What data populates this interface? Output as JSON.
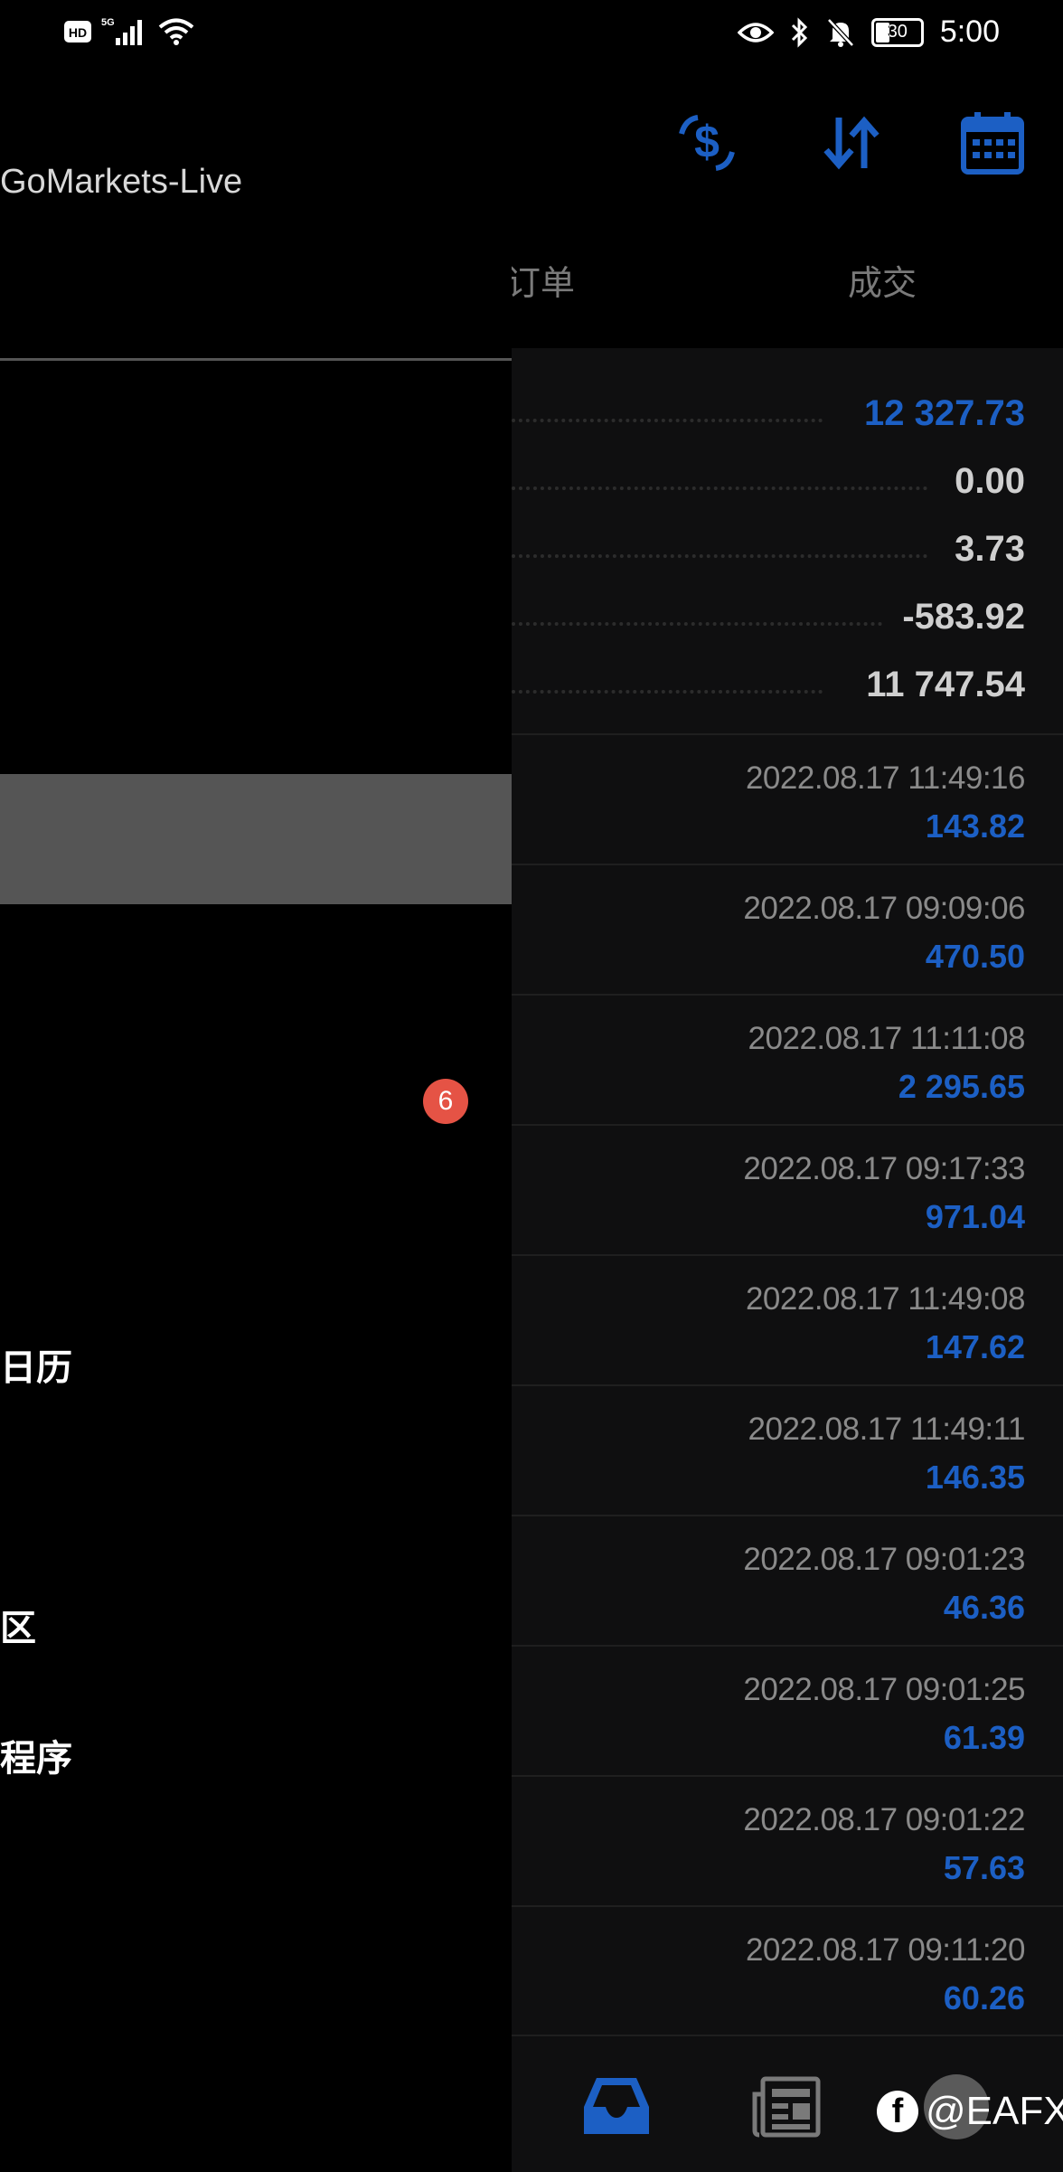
{
  "status_bar": {
    "network": "HD 5G",
    "battery": "30",
    "time": "5:00"
  },
  "header": {
    "account_title": "GoMarkets-Live",
    "tabs": [
      {
        "label": "订单"
      },
      {
        "label": "成交"
      }
    ],
    "icons": [
      "currency-exchange-icon",
      "sort-icon",
      "calendar-icon"
    ]
  },
  "summary": [
    {
      "value": "12 327.73",
      "accent": "blue"
    },
    {
      "value": "0.00",
      "accent": "gray"
    },
    {
      "value": "3.73",
      "accent": "gray"
    },
    {
      "value": "-583.92",
      "accent": "gray"
    },
    {
      "value": "11 747.54",
      "accent": "gray"
    }
  ],
  "deals": [
    {
      "time": "2022.08.17 11:49:16",
      "amount": "143.82"
    },
    {
      "time": "2022.08.17 09:09:06",
      "amount": "470.50"
    },
    {
      "time": "2022.08.17 11:11:08",
      "amount": "2 295.65"
    },
    {
      "time": "2022.08.17 09:17:33",
      "amount": "971.04"
    },
    {
      "time": "2022.08.17 11:49:08",
      "amount": "147.62"
    },
    {
      "time": "2022.08.17 11:49:11",
      "amount": "146.35"
    },
    {
      "time": "2022.08.17 09:01:23",
      "amount": "46.36"
    },
    {
      "time": "2022.08.17 09:01:25",
      "amount": "61.39"
    },
    {
      "time": "2022.08.17 09:01:22",
      "amount": "57.63"
    },
    {
      "time": "2022.08.17 09:11:20",
      "amount": "60.26"
    }
  ],
  "drawer": {
    "badge_count": "6",
    "items": [
      {
        "label": "日历"
      },
      {
        "label": "区"
      },
      {
        "label": "程序"
      }
    ]
  },
  "watermark": {
    "text": "@EAFX"
  },
  "colors": {
    "accent": "#1c5fc4",
    "badge": "#e55345"
  }
}
